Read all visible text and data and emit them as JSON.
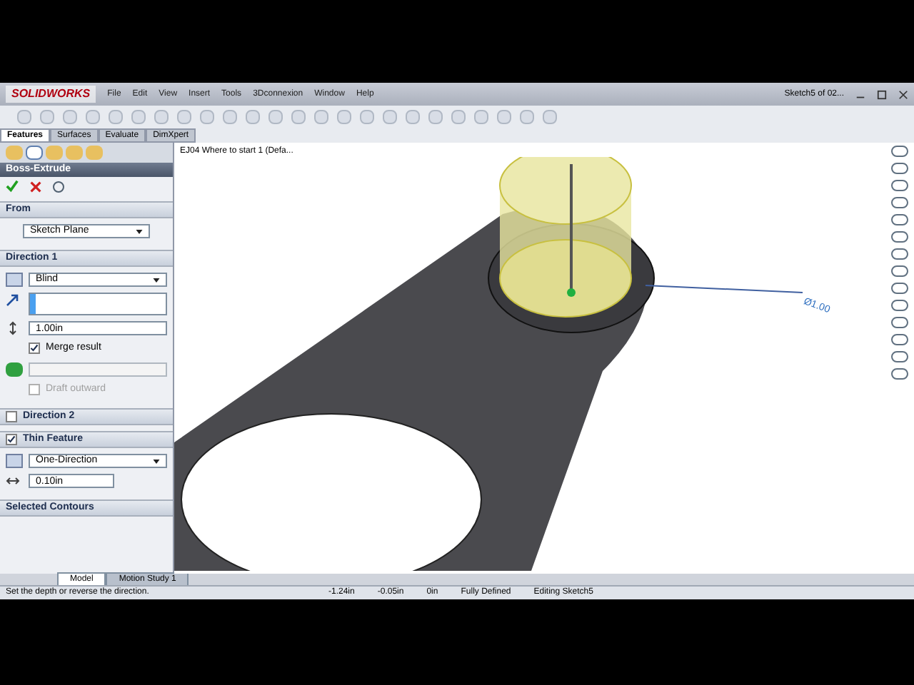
{
  "app": {
    "logo": "SOLIDWORKS",
    "menus": [
      "File",
      "Edit",
      "View",
      "Insert",
      "Tools",
      "3Dconnexion",
      "Window",
      "Help"
    ],
    "document_title": "Sketch5 of 02..."
  },
  "command_tabs": [
    {
      "label": "Features",
      "selected": true
    },
    {
      "label": "Surfaces",
      "selected": false
    },
    {
      "label": "Evaluate",
      "selected": false
    },
    {
      "label": "DimXpert",
      "selected": false
    }
  ],
  "manager_tabs": [
    {
      "selected": false
    },
    {
      "selected": true
    },
    {
      "selected": false
    },
    {
      "selected": false
    },
    {
      "selected": false
    }
  ],
  "property_manager": {
    "title": "Boss-Extrude",
    "from": {
      "heading": "From",
      "value": "Sketch Plane"
    },
    "direction1": {
      "heading": "Direction 1",
      "end_condition": "Blind",
      "depth": "1.00in",
      "merge_result": {
        "label": "Merge result",
        "checked": true
      },
      "draft_outward": {
        "label": "Draft outward",
        "checked": false
      }
    },
    "direction2": {
      "heading": "Direction 2",
      "checked": false
    },
    "thin_feature": {
      "heading": "Thin Feature",
      "checked": true,
      "type": "One-Direction",
      "thickness": "0.10in"
    },
    "selected_contours": {
      "heading": "Selected Contours"
    }
  },
  "tree_item": "EJ04 Where to start 1 (Defa...",
  "dimension": "Ø1.00",
  "bottom_tabs": [
    {
      "label": "Model",
      "selected": true
    },
    {
      "label": "Motion Study 1",
      "selected": false
    }
  ],
  "status_bar": {
    "message": "Set the depth or reverse the direction.",
    "x": "-1.24in",
    "y": "-0.05in",
    "z": "0in",
    "state": "Fully Defined",
    "mode": "Editing Sketch5"
  }
}
